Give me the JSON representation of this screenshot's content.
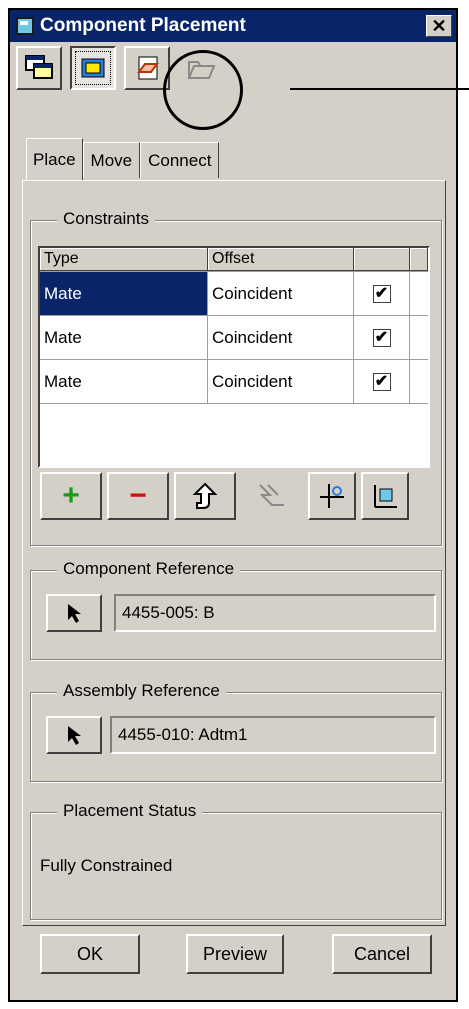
{
  "window": {
    "title": "Component Placement",
    "close_glyph": "✕"
  },
  "toolbar": {
    "buttons": [
      {
        "name": "placement-icon-1"
      },
      {
        "name": "placement-icon-2"
      },
      {
        "name": "placement-icon-3"
      },
      {
        "name": "placement-icon-4"
      }
    ]
  },
  "tabs": [
    "Place",
    "Move",
    "Connect"
  ],
  "constraints": {
    "legend": "Constraints",
    "headers": {
      "type": "Type",
      "offset": "Offset"
    },
    "rows": [
      {
        "type": "Mate",
        "offset": "Coincident",
        "checked": "☑"
      },
      {
        "type": "Mate",
        "offset": "Coincident",
        "checked": "☑"
      },
      {
        "type": "Mate",
        "offset": "Coincident",
        "checked": "☑"
      }
    ],
    "buttons": {
      "add": "+",
      "remove": "−"
    }
  },
  "component_reference": {
    "legend": "Component Reference",
    "value": "4455-005: B"
  },
  "assembly_reference": {
    "legend": "Assembly Reference",
    "value": "4455-010: Adtm1"
  },
  "placement_status": {
    "legend": "Placement Status",
    "text": "Fully Constrained"
  },
  "dialog_buttons": {
    "ok": "OK",
    "preview": "Preview",
    "cancel": "Cancel"
  },
  "colors": {
    "title_bg": "#0a246a",
    "face": "#d4d0c8",
    "add": "#1a9a1a",
    "remove": "#d01010"
  }
}
